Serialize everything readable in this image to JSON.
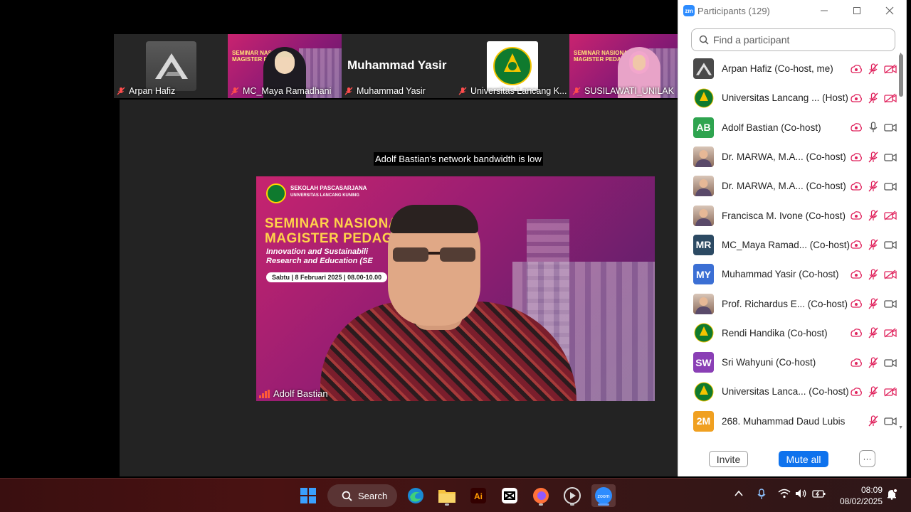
{
  "thumbnails": [
    {
      "name": "Arpan Hafiz",
      "kind": "logo"
    },
    {
      "name": "MC_Maya Ramadhani",
      "kind": "video"
    },
    {
      "name": "Muhammad Yasir",
      "kind": "name",
      "display_name": "Muhammad Yasir"
    },
    {
      "name": "Universitas Lancang K...",
      "kind": "unilogo"
    },
    {
      "name": "SUSILAWATI_UNILAK",
      "kind": "video"
    }
  ],
  "stage": {
    "bandwidth_notice": "Adolf Bastian's network bandwidth is low",
    "speaker_name": "Adolf Bastian",
    "poster": {
      "header_line1": "SEKOLAH PASCASARJANA",
      "header_line2": "UNIVERSITAS LANCANG KUNING",
      "title_line1": "SEMINAR NASIONA",
      "title_line2": "MAGISTER PEDAG",
      "sub_line1": "Innovation and Sustainabili",
      "sub_line2": "Research and Education (SE",
      "date_text": "Sabtu  |  8 Februari 2025  |  08.00-10.00"
    }
  },
  "panel": {
    "title": "Participants (129)",
    "search_placeholder": "Find a participant",
    "invite_label": "Invite",
    "mute_all_label": "Mute all",
    "more_label": "···",
    "participants": [
      {
        "name": "Arpan Hafiz (Co-host, me)",
        "avatar": "logo",
        "mic": "off",
        "cam": "off"
      },
      {
        "name": "Universitas Lancang ...  (Host)",
        "avatar": "uni",
        "mic": "off",
        "cam": "off"
      },
      {
        "name": "Adolf Bastian (Co-host)",
        "avatar": "AB",
        "avatar_color": "#2ea44f",
        "mic": "on",
        "cam": "on"
      },
      {
        "name": "Dr. MARWA, M.A...  (Co-host)",
        "avatar": "photo",
        "mic": "off",
        "cam": "on"
      },
      {
        "name": "Dr. MARWA, M.A...  (Co-host)",
        "avatar": "photo",
        "mic": "off",
        "cam": "on"
      },
      {
        "name": "Francisca M. Ivone (Co-host)",
        "avatar": "photo",
        "mic": "off",
        "cam": "off"
      },
      {
        "name": "MC_Maya Ramad...  (Co-host)",
        "avatar": "MR",
        "avatar_color": "#2c4a63",
        "mic": "off",
        "cam": "on"
      },
      {
        "name": "Muhammad Yasir (Co-host)",
        "avatar": "MY",
        "avatar_color": "#3b6fd4",
        "mic": "off",
        "cam": "off"
      },
      {
        "name": "Prof. Richardus E...  (Co-host)",
        "avatar": "photo",
        "mic": "off",
        "cam": "on"
      },
      {
        "name": "Rendi Handika (Co-host)",
        "avatar": "uni",
        "mic": "off",
        "cam": "off"
      },
      {
        "name": "Sri Wahyuni (Co-host)",
        "avatar": "SW",
        "avatar_color": "#8a3fb5",
        "mic": "off",
        "cam": "on"
      },
      {
        "name": "Universitas Lanca...  (Co-host)",
        "avatar": "uni",
        "mic": "off",
        "cam": "off"
      },
      {
        "name": "268. Muhammad Daud Lubis",
        "avatar": "2M",
        "avatar_color": "#f0a020",
        "mic": "off",
        "cam": "on",
        "no_share": true
      }
    ]
  },
  "taskbar": {
    "search_label": "Search",
    "time": "08:09",
    "date": "08/02/2025"
  }
}
